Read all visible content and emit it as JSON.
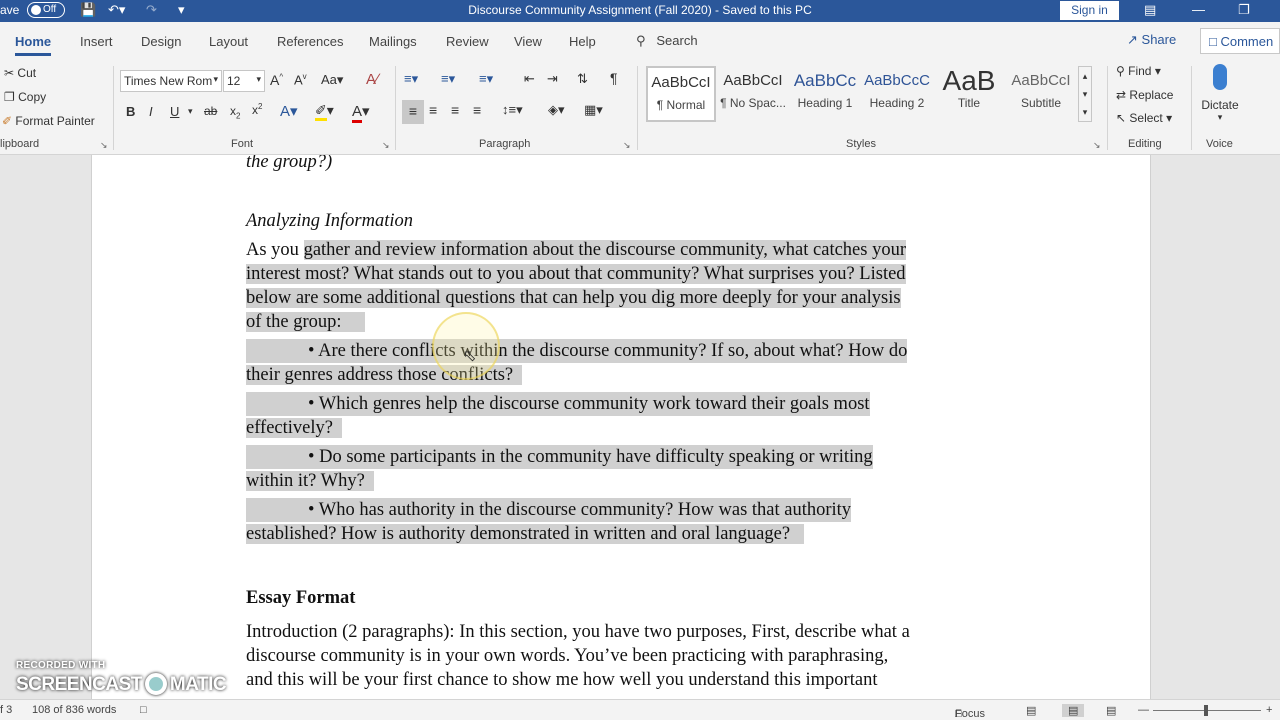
{
  "titlebar": {
    "autosave_label": "ave",
    "autosave_toggle": "Off",
    "save_icon": "save-icon",
    "doc_title": "Discourse Community Assignment (Fall 2020)  -  Saved to this PC",
    "signin": "Sign in"
  },
  "tabs": [
    "Home",
    "Insert",
    "Design",
    "Layout",
    "References",
    "Mailings",
    "Review",
    "View",
    "Help"
  ],
  "search_label": "Search",
  "share_label": "Share",
  "comments_label": "Commen",
  "ribbon": {
    "clipboard": {
      "cut": "Cut",
      "copy": "Copy",
      "format_painter": "Format Painter",
      "label": "lipboard"
    },
    "font": {
      "family": "Times New Rom",
      "size": "12",
      "label": "Font",
      "bold": "B",
      "italic": "I",
      "underline": "U",
      "strike": "ab",
      "sub": "x",
      "sup": "x"
    },
    "paragraph": {
      "label": "Paragraph"
    },
    "styles": {
      "label": "Styles",
      "items": [
        {
          "preview": "AaBbCcI",
          "name": "¶ Normal"
        },
        {
          "preview": "AaBbCcI",
          "name": "¶ No Spac..."
        },
        {
          "preview": "AaBbCc",
          "name": "Heading 1"
        },
        {
          "preview": "AaBbCcC",
          "name": "Heading 2"
        },
        {
          "preview": "AaB",
          "name": "Title"
        },
        {
          "preview": "AaBbCcI",
          "name": "Subtitle"
        }
      ]
    },
    "editing": {
      "find": "Find",
      "replace": "Replace",
      "select": "Select",
      "label": "Editing"
    },
    "voice": {
      "dictate": "Dictate",
      "label": "Voice"
    }
  },
  "document": {
    "line_top": "the group?)",
    "heading_analyzing": "Analyzing Information",
    "para1": [
      {
        "pre": "As you ",
        "hl": "gather and review information about the discourse community, what catches your"
      },
      {
        "pre": "",
        "hl": "interest most? What stands out to you about that community? What surprises you? Listed"
      },
      {
        "pre": "",
        "hl": "below are some additional questions that can help you dig more deeply for your analysis"
      },
      {
        "pre": "",
        "hl": "of the group:"
      }
    ],
    "bullets": [
      [
        "• Are there conflicts within the discourse community? If so, about what? How do",
        "their genres address those conflicts?"
      ],
      [
        "• Which genres help the discourse community work toward their goals most",
        "effectively?"
      ],
      [
        "• Do some participants in the community have difficulty speaking or writing",
        "within it? Why?"
      ],
      [
        "• Who has authority in the discourse community? How was that authority",
        "established? How is authority demonstrated in written and oral language?"
      ]
    ],
    "heading_essay": "Essay Format",
    "intro_lines": [
      "Introduction (2 paragraphs): In this section, you have two purposes, First, describe what a",
      "discourse community is in your own words. You’ve been practicing with paraphrasing,",
      "and this will be your first chance to show me how well you understand this important"
    ]
  },
  "status": {
    "page": "f 3",
    "words": "108 of 836 words",
    "focus": "Focus"
  },
  "watermark": {
    "recorded": "RECORDED WITH",
    "brand_left": "SCREENCAST",
    "brand_right": "MATIC"
  }
}
